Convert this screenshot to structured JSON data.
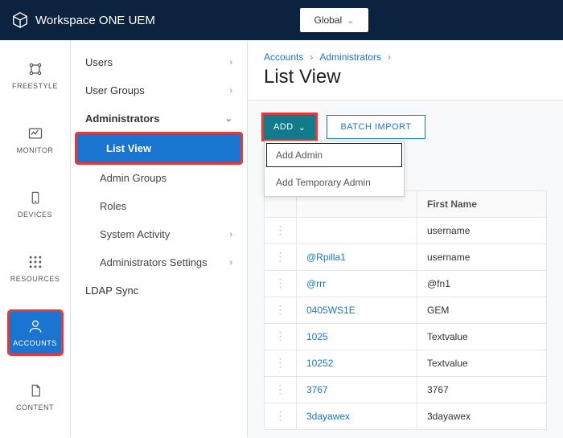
{
  "header": {
    "product": "Workspace ONE UEM",
    "org": "Global"
  },
  "rail": {
    "freestyle": "FREESTYLE",
    "monitor": "MONITOR",
    "devices": "DEVICES",
    "resources": "RESOURCES",
    "accounts": "ACCOUNTS",
    "content": "CONTENT"
  },
  "sidenav": {
    "users": "Users",
    "user_groups": "User Groups",
    "administrators": "Administrators",
    "list_view": "List View",
    "admin_groups": "Admin Groups",
    "roles": "Roles",
    "system_activity": "System Activity",
    "admin_settings": "Administrators Settings",
    "ldap_sync": "LDAP Sync"
  },
  "breadcrumb": {
    "a": "Accounts",
    "b": "Administrators"
  },
  "page_title": "List View",
  "buttons": {
    "add": "ADD",
    "batch": "BATCH IMPORT"
  },
  "dropdown": {
    "add_admin": "Add Admin",
    "add_temp": "Add Temporary Admin"
  },
  "table": {
    "col_first": "First Name",
    "rows": [
      {
        "user": "",
        "first": "username"
      },
      {
        "user": "@Rpilla1",
        "first": "username"
      },
      {
        "user": "@rrr",
        "first": "@fn1"
      },
      {
        "user": "0405WS1E",
        "first": "GEM"
      },
      {
        "user": "1025",
        "first": "Textvalue"
      },
      {
        "user": "10252",
        "first": "Textvalue"
      },
      {
        "user": "3767",
        "first": "3767"
      },
      {
        "user": "3dayawex",
        "first": "3dayawex"
      }
    ]
  }
}
